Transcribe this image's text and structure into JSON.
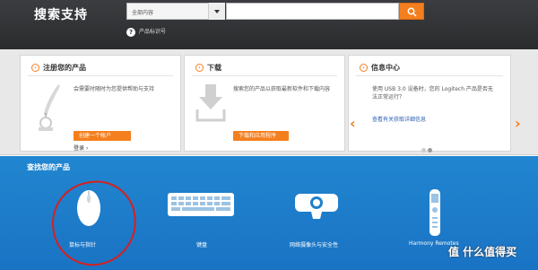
{
  "header": {
    "title": "搜索支持",
    "search_scope": "全部内容",
    "search_placeholder": "",
    "help_text": "产品标识号",
    "search_icon": "search-icon"
  },
  "panels": [
    {
      "title": "注册您的产品",
      "text": "会需要时随时为您提供帮助与支持",
      "button": "创建一个帐户",
      "link": "登录",
      "icon": "pen-icon"
    },
    {
      "title": "下载",
      "text": "搜索您的产品以获取最新软件和下载内容",
      "button": "下载和应用程序",
      "icon": "download-icon"
    },
    {
      "title": "信息中心",
      "text": "使用 USB 3.0 设备时，您的 Logitech 产品是否无法正常运行？",
      "link": "查看有关获取详细信息",
      "icon": "arrow-circle-icon"
    }
  ],
  "carousel": {
    "prev": "‹",
    "next": "›",
    "dots": 2,
    "active_dot": 1
  },
  "products": {
    "title": "查找您的产品",
    "items": [
      {
        "label": "鼠标与指针",
        "icon": "mouse-icon"
      },
      {
        "label": "键盘",
        "icon": "keyboard-icon"
      },
      {
        "label": "网络摄像头与安全性",
        "icon": "webcam-icon"
      },
      {
        "label": "Harmony Remotes",
        "icon": "remote-icon"
      }
    ]
  },
  "watermark": "值 什么值得买",
  "colors": {
    "accent": "#f47f1f",
    "header": "#2f3033",
    "products_bg": "#1f80cc",
    "annotation": "#d62020"
  }
}
